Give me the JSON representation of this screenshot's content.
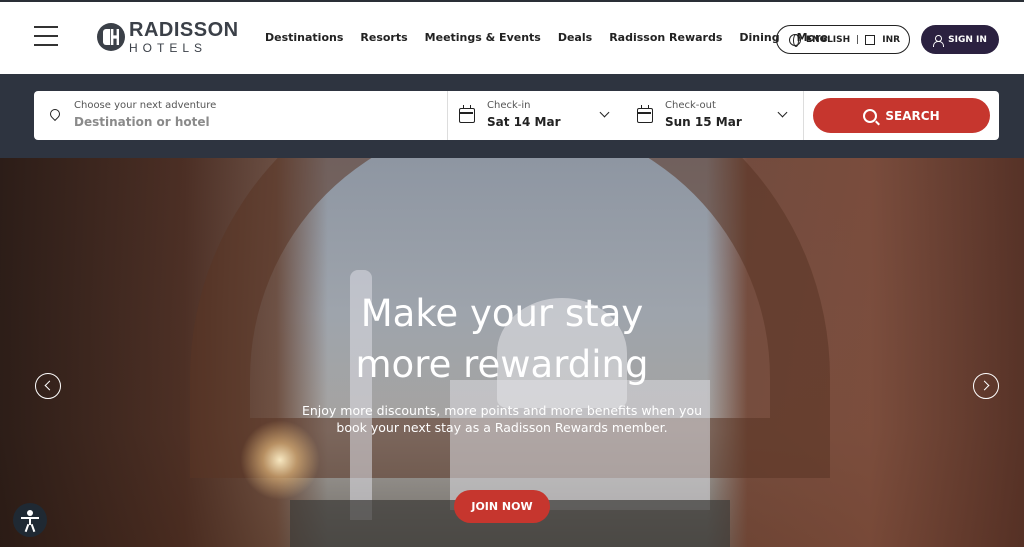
{
  "header": {
    "logo": {
      "top": "RADISSON",
      "bottom": "HOTELS",
      "mark": "RH"
    },
    "nav": [
      "Destinations",
      "Resorts",
      "Meetings & Events",
      "Deals",
      "Radisson Rewards",
      "Dining",
      "More"
    ],
    "language": "ENGLISH",
    "currency": "INR",
    "sign_in": "SIGN IN"
  },
  "search": {
    "destination_label": "Choose your next adventure",
    "destination_placeholder": "Destination or hotel",
    "checkin_label": "Check-in",
    "checkin_value": "Sat 14 Mar",
    "checkout_label": "Check-out",
    "checkout_value": "Sun 15 Mar",
    "button_label": "SEARCH"
  },
  "hero": {
    "title_line1": "Make your stay",
    "title_line2": "more rewarding",
    "subtitle": "Enjoy more discounts, more points and more benefits when you book your next stay as a Radisson Rewards member.",
    "cta": "JOIN NOW"
  },
  "colors": {
    "accent": "#c6362e",
    "sign_in_bg": "#2b2140",
    "search_band": "#2e3440"
  },
  "icons": [
    "menu-icon",
    "globe-icon",
    "currency-icon",
    "user-icon",
    "location-pin-icon",
    "calendar-icon",
    "chevron-down-icon",
    "search-icon",
    "chevron-left-icon",
    "chevron-right-icon",
    "accessibility-icon"
  ]
}
